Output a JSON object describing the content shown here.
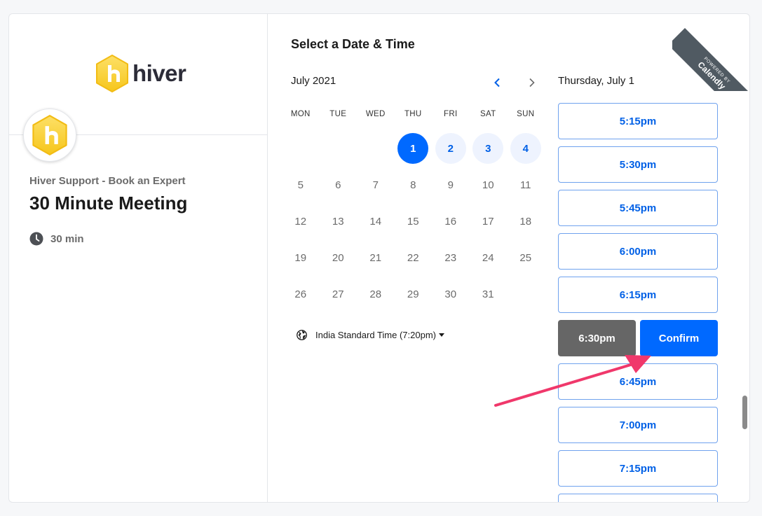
{
  "brand": {
    "logo_text": "hiver"
  },
  "event": {
    "org_name": "Hiver Support - Book an Expert",
    "title": "30 Minute Meeting",
    "duration": "30 min"
  },
  "scheduler": {
    "heading": "Select a Date & Time",
    "month_label": "July 2021",
    "weekdays": [
      "MON",
      "TUE",
      "WED",
      "THU",
      "FRI",
      "SAT",
      "SUN"
    ],
    "days": [
      "1",
      "2",
      "3",
      "4",
      "5",
      "6",
      "7",
      "8",
      "9",
      "10",
      "11",
      "12",
      "13",
      "14",
      "15",
      "16",
      "17",
      "18",
      "19",
      "20",
      "21",
      "22",
      "23",
      "24",
      "25",
      "26",
      "27",
      "28",
      "29",
      "30",
      "31"
    ],
    "selected_day": "1",
    "available_days": [
      "1",
      "2",
      "3",
      "4"
    ],
    "timezone": "India Standard Time (7:20pm)",
    "selected_date_label": "Thursday, July 1"
  },
  "slots": {
    "times": [
      "5:15pm",
      "5:30pm",
      "5:45pm",
      "6:00pm",
      "6:15pm",
      "6:30pm",
      "6:45pm",
      "7:00pm",
      "7:15pm"
    ],
    "selected": "6:30pm",
    "confirm_label": "Confirm"
  },
  "ribbon": {
    "powered_by": "POWERED BY",
    "brand": "Calendly"
  },
  "colors": {
    "accent": "#0069ff",
    "slot_border": "#6fa2ee",
    "selected_slot": "#666666",
    "available_day_bg": "#eef3fe",
    "annotation_arrow": "#f0386b",
    "hiver_yellow": "#fcd12a"
  }
}
